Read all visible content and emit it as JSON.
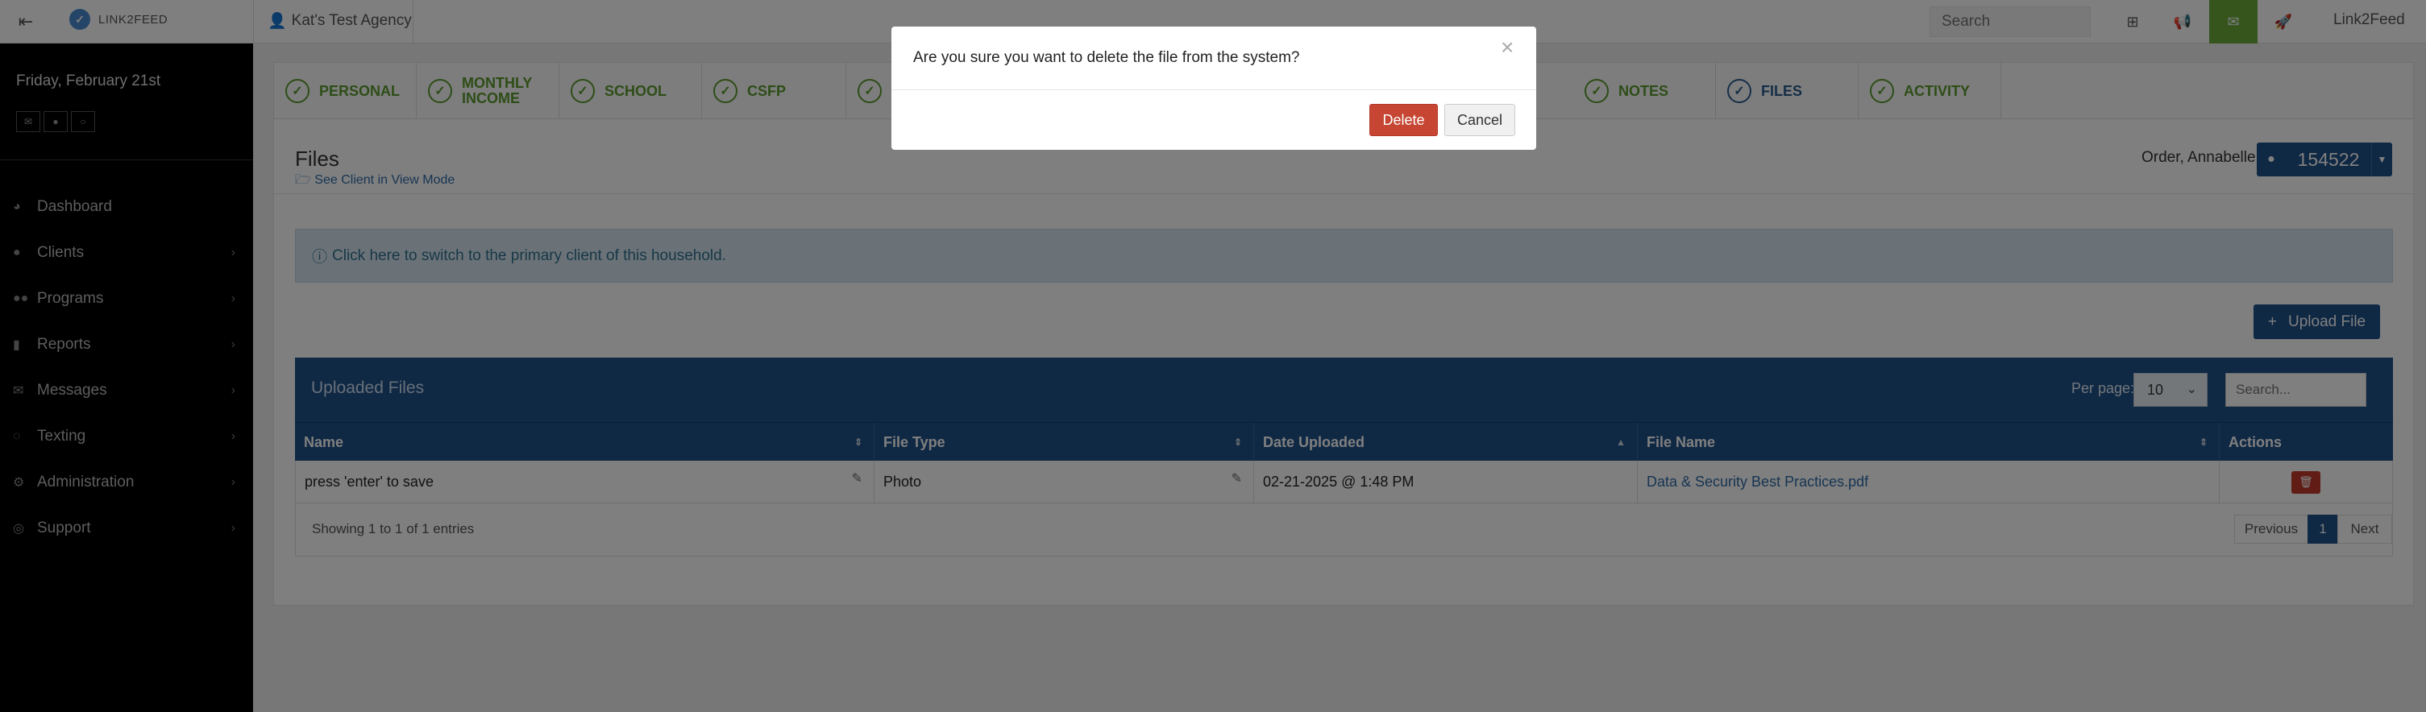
{
  "topbar": {
    "brand": "LINK2FEED",
    "agency": "Kat's Test Agency",
    "search_placeholder": "Search",
    "user": "Link2Feed"
  },
  "sidebar": {
    "date": "Friday, February 21st",
    "items": [
      {
        "label": "Dashboard",
        "icon": "dashboard-icon"
      },
      {
        "label": "Clients",
        "icon": "user-icon"
      },
      {
        "label": "Programs",
        "icon": "users-icon"
      },
      {
        "label": "Reports",
        "icon": "bar-chart-icon"
      },
      {
        "label": "Messages",
        "icon": "envelope-icon"
      },
      {
        "label": "Texting",
        "icon": "chat-icon"
      },
      {
        "label": "Administration",
        "icon": "cogs-icon"
      },
      {
        "label": "Support",
        "icon": "lifebuoy-icon"
      }
    ]
  },
  "tabs": [
    {
      "label": "PERSONAL"
    },
    {
      "label": "MONTHLY INCOME"
    },
    {
      "label": "SCHOOL"
    },
    {
      "label": "CSFP"
    },
    {
      "label": ""
    },
    {
      "label": "NOTES"
    },
    {
      "label": "FILES"
    },
    {
      "label": "ACTIVITY"
    }
  ],
  "page": {
    "title": "Files",
    "see_client": "See Client in View Mode",
    "client_name": "Order, Annabelle",
    "client_id": "154522",
    "info_message": "Click here to switch to the primary client of this household.",
    "upload_label": "Upload File"
  },
  "table": {
    "title": "Uploaded Files",
    "per_page_label": "Per page:",
    "per_page_value": "10",
    "search_placeholder": "Search...",
    "columns": [
      "Name",
      "File Type",
      "Date Uploaded",
      "File Name",
      "Actions"
    ],
    "rows": [
      {
        "name": "press 'enter' to save",
        "file_type": "Photo",
        "date_uploaded": "02-21-2025 @ 1:48 PM",
        "file_name": "Data & Security Best Practices.pdf"
      }
    ],
    "showing": "Showing 1 to 1 of 1 entries",
    "pagination": {
      "previous": "Previous",
      "page": "1",
      "next": "Next"
    }
  },
  "modal": {
    "message": "Are you sure you want to delete the file from the system?",
    "close": "×",
    "delete_label": "Delete",
    "cancel_label": "Cancel"
  },
  "colors": {
    "primary": "#1f5089",
    "success": "#5b9a2e",
    "danger": "#c64633",
    "info_bg": "#d4e4ef"
  }
}
